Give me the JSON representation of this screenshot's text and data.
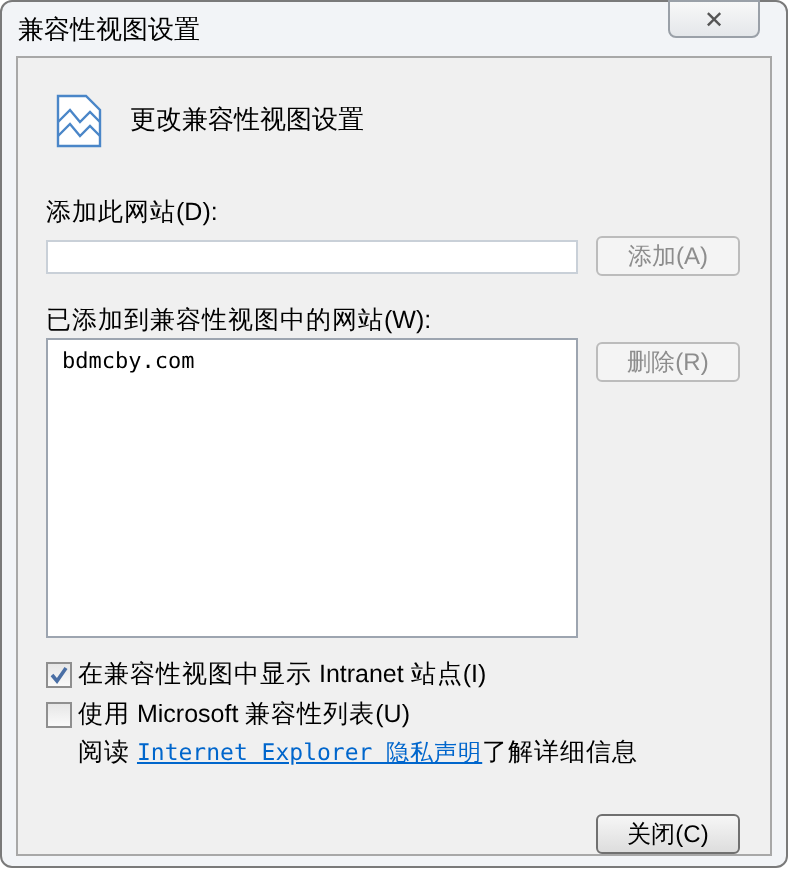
{
  "window": {
    "title": "兼容性视图设置",
    "close": "✕"
  },
  "header": {
    "title": "更改兼容性视图设置"
  },
  "add_site": {
    "label": "添加此网站(D):",
    "button": {
      "label": "添加(A)",
      "disabled": true
    }
  },
  "sites": {
    "label": "已添加到兼容性视图中的网站(W):",
    "items": [
      {
        "text": "bdmcby.com",
        "selected": false
      }
    ],
    "button": {
      "label": "删除(R)",
      "disabled": true
    }
  },
  "options": [
    {
      "label": "在兼容性视图中显示 Intranet 站点(I)",
      "checked": true
    },
    {
      "label": "使用 Microsoft 兼容性列表(U)",
      "checked": false
    }
  ],
  "privacy": {
    "before": "阅读 ",
    "link": "Internet Explorer 隐私声明",
    "after": "了解详细信息"
  },
  "close_button": {
    "label": "关闭(C)",
    "disabled": false
  }
}
